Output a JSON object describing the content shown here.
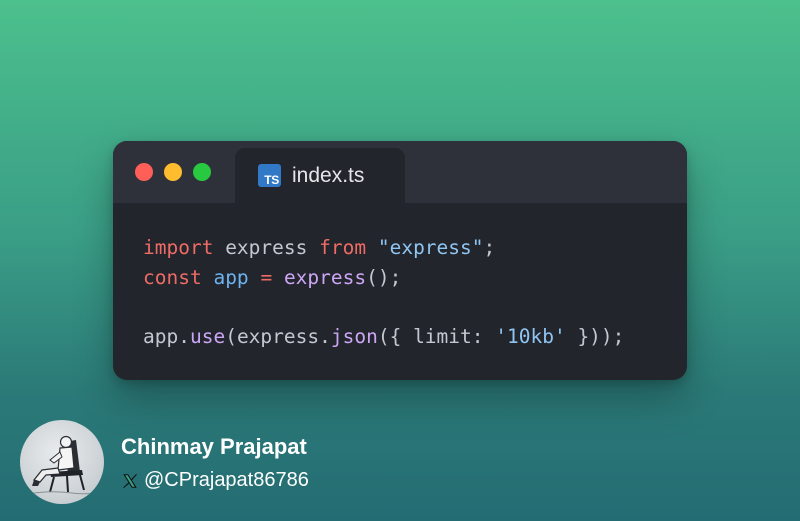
{
  "window": {
    "tab": {
      "icon": "typescript-icon",
      "icon_text": "TS",
      "label": "index.ts"
    },
    "traffic_lights": [
      {
        "name": "close",
        "color": "#ff5f57"
      },
      {
        "name": "minimize",
        "color": "#febc2e"
      },
      {
        "name": "maximize",
        "color": "#28c840"
      }
    ]
  },
  "code": {
    "language": "typescript",
    "lines": [
      [
        {
          "text": "import",
          "color": "#ee6b66"
        },
        {
          "text": " express ",
          "color": "#c3c7cf"
        },
        {
          "text": "from",
          "color": "#ee6b66"
        },
        {
          "text": " ",
          "color": "#c3c7cf"
        },
        {
          "text": "\"express\"",
          "color": "#8fc5f2"
        },
        {
          "text": ";",
          "color": "#c3c7cf"
        }
      ],
      [
        {
          "text": "const",
          "color": "#ee6b66"
        },
        {
          "text": " ",
          "color": "#c3c7cf"
        },
        {
          "text": "app",
          "color": "#6cb3f0"
        },
        {
          "text": " ",
          "color": "#c3c7cf"
        },
        {
          "text": "=",
          "color": "#ee6b66"
        },
        {
          "text": " ",
          "color": "#c3c7cf"
        },
        {
          "text": "express",
          "color": "#cca6f5"
        },
        {
          "text": "();",
          "color": "#c3c7cf"
        }
      ],
      [],
      [
        {
          "text": "app.",
          "color": "#c3c7cf"
        },
        {
          "text": "use",
          "color": "#cca6f5"
        },
        {
          "text": "(express.",
          "color": "#c3c7cf"
        },
        {
          "text": "json",
          "color": "#cca6f5"
        },
        {
          "text": "({ limit: ",
          "color": "#c3c7cf"
        },
        {
          "text": "'10kb'",
          "color": "#8fc5f2"
        },
        {
          "text": " }));",
          "color": "#c3c7cf"
        }
      ]
    ]
  },
  "author": {
    "name": "Chinmay Prajapat",
    "handle": "@CPrajapat86786",
    "platform_icon": "x-logo-icon"
  },
  "colors": {
    "background_top": "#4cc08d",
    "background_bottom": "#246c73",
    "window_body": "#22252b",
    "window_titlebar": "#2e3139",
    "typescript_blue": "#3178c6"
  }
}
